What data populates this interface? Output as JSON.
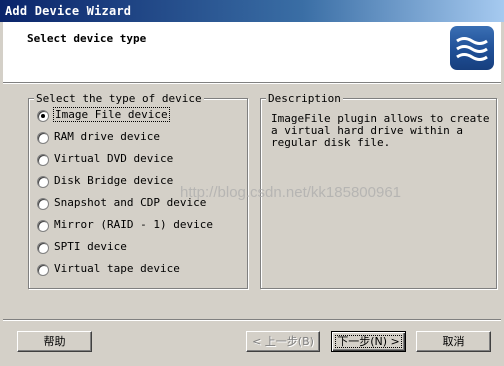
{
  "window": {
    "title": "Add Device Wizard"
  },
  "header": {
    "title": "Select device type",
    "logo": "wave-logo"
  },
  "device_types": {
    "legend": "Select the type of device",
    "selected_index": 0,
    "options": [
      {
        "label": "Image File device"
      },
      {
        "label": "RAM drive device"
      },
      {
        "label": "Virtual DVD device"
      },
      {
        "label": "Disk Bridge device"
      },
      {
        "label": "Snapshot and CDP device"
      },
      {
        "label": "Mirror (RAID - 1) device"
      },
      {
        "label": "SPTI device"
      },
      {
        "label": "Virtual tape device"
      }
    ]
  },
  "description": {
    "legend": "Description",
    "lines": [
      "ImageFile plugin allows to create",
      "a virtual hard drive within a",
      "regular disk file."
    ]
  },
  "watermark": "http://blog.csdn.net/kk185800961",
  "buttons": {
    "help": "帮助",
    "back": "< 上一步(B)",
    "next": "下一步(N) >",
    "cancel": "取消"
  }
}
